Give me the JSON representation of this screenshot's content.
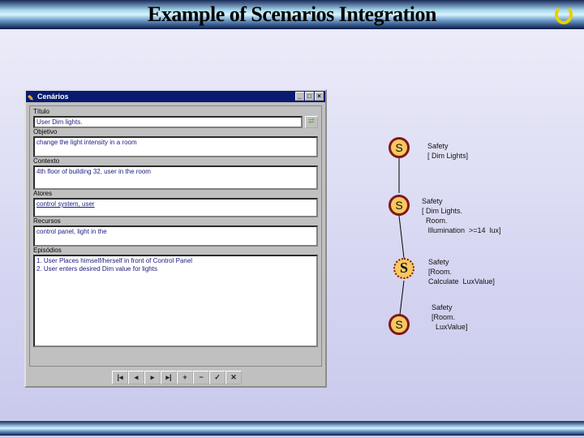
{
  "slide": {
    "title": "Example of Scenarios Integration",
    "logo_icon": "refresh-arrow-icon"
  },
  "window": {
    "title": "Cenários",
    "fields": [
      {
        "label": "Título",
        "value": "User Dim lights."
      },
      {
        "label": "Objetivo",
        "value": "change the light intensity in a room"
      },
      {
        "label": "Contexto",
        "value": "4th floor of building 32, user in the room"
      },
      {
        "label": "Atores",
        "value": "control system, user"
      },
      {
        "label": "Recursos",
        "value": "control panel, light in the"
      },
      {
        "label": "Episódios",
        "lines": [
          "1. User Places himself/herself in front of Control Panel",
          "2. User enters desired Dim value for lights"
        ]
      }
    ],
    "nav_buttons": [
      "|◂",
      "◂",
      "▸",
      "▸|",
      "+",
      "−",
      "✓",
      "✕"
    ]
  },
  "diagram": {
    "nodes": [
      {
        "symbol": "S",
        "text": "Safety\n[ Dim Lights]"
      },
      {
        "symbol": "S",
        "text": "Safety\n[ Dim Lights.\n  Room.\n   Illumination  >=14  lux]"
      },
      {
        "symbol": "S",
        "text": "Safety\n[Room.\nCalculate  LuxValue]"
      },
      {
        "symbol": "S",
        "text": "Safety\n[Room.\n  LuxValue]"
      }
    ]
  }
}
